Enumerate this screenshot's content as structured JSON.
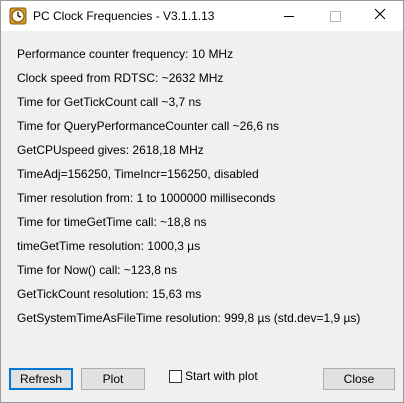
{
  "window": {
    "title": "PC Clock Frequencies - V3.1.1.13",
    "icon": "clock-icon",
    "controls": {
      "minimize": "minimize-icon",
      "maximize": "maximize-icon",
      "close": "close-icon"
    }
  },
  "lines": [
    "Performance counter frequency: 10 MHz",
    "Clock speed from RDTSC: ~2632 MHz",
    "Time for GetTickCount call ~3,7 ns",
    "Time for QueryPerformanceCounter call ~26,6 ns",
    "GetCPUspeed gives: 2618,18 MHz",
    "TimeAdj=156250, TimeIncr=156250, disabled",
    "Timer resolution from: 1 to 1000000 milliseconds",
    "Time for timeGetTime call: ~18,8 ns",
    "timeGetTime resolution: 1000,3 µs",
    "Time for Now() call: ~123,8 ns",
    "GetTickCount resolution: 15,63 ms",
    "GetSystemTimeAsFileTime resolution: 999,8 µs  (std.dev=1,9 µs)"
  ],
  "buttons": {
    "refresh": "Refresh",
    "plot": "Plot",
    "close": "Close"
  },
  "start_with_plot": {
    "label": "Start with plot",
    "checked": false
  },
  "colors": {
    "accent": "#0078d7",
    "background": "#f0f0f0",
    "titlebar": "#ffffff"
  }
}
